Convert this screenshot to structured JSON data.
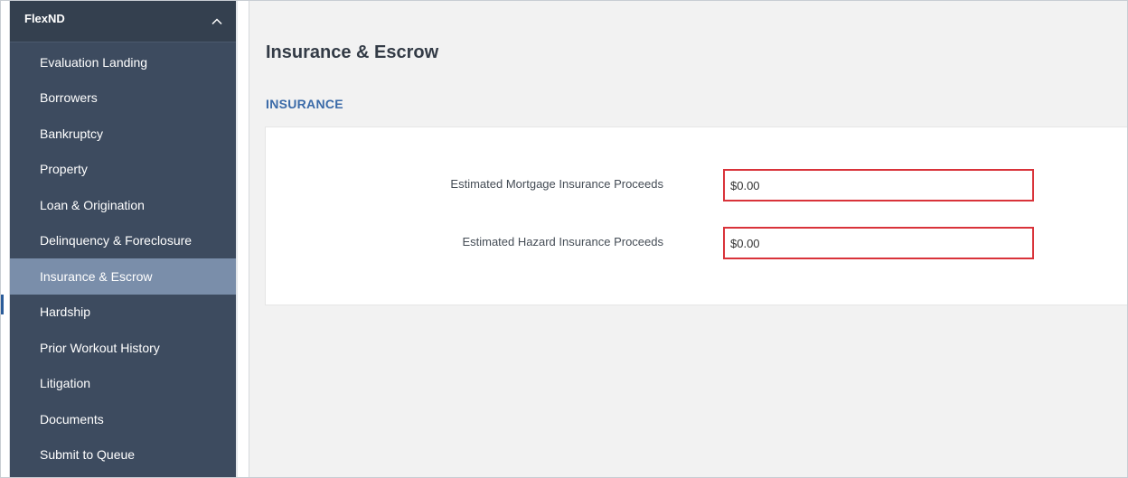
{
  "sidebar": {
    "title": "FlexND",
    "collapse_icon": "chevron-up-icon",
    "items": [
      {
        "label": "Evaluation Landing",
        "active": false
      },
      {
        "label": "Borrowers",
        "active": false
      },
      {
        "label": "Bankruptcy",
        "active": false
      },
      {
        "label": "Property",
        "active": false
      },
      {
        "label": "Loan & Origination",
        "active": false
      },
      {
        "label": "Delinquency & Foreclosure",
        "active": false
      },
      {
        "label": "Insurance & Escrow",
        "active": true
      },
      {
        "label": "Hardship",
        "active": false
      },
      {
        "label": "Prior Workout History",
        "active": false
      },
      {
        "label": "Litigation",
        "active": false
      },
      {
        "label": "Documents",
        "active": false
      },
      {
        "label": "Submit to Queue",
        "active": false
      }
    ]
  },
  "main": {
    "page_title": "Insurance & Escrow",
    "section_title": "INSURANCE",
    "fields": [
      {
        "label": "Estimated Mortgage Insurance Proceeds",
        "value": "$0.00"
      },
      {
        "label": "Estimated Hazard Insurance Proceeds",
        "value": "$0.00"
      }
    ]
  },
  "colors": {
    "sidebar_bg": "#3d4b5f",
    "sidebar_active": "#7a8eaa",
    "section_accent": "#3a6aa8",
    "highlight_border": "#d9333a"
  }
}
